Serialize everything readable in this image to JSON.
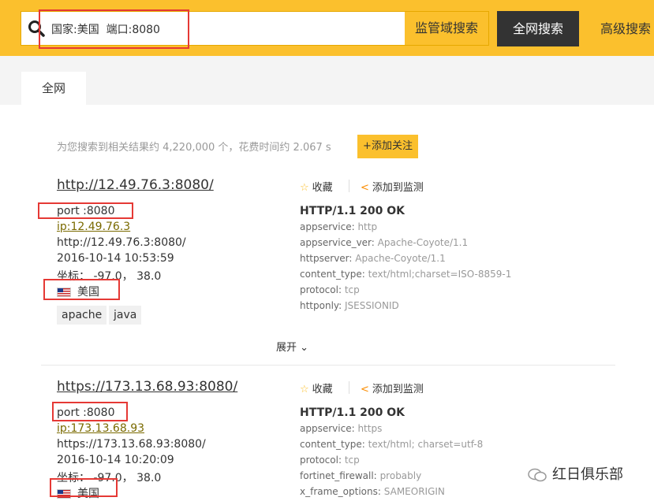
{
  "header": {
    "search_value": "国家:美国  端口:8080",
    "domain_search_label": "监管域搜索",
    "global_search_label": "全网搜索",
    "advanced_search_label": "高级搜索"
  },
  "tabs": [
    {
      "label": "全网"
    }
  ],
  "summary": {
    "text": "为您搜索到相关结果约 4,220,000 个，花费时间约 2.067 s",
    "follow_label": "+添加关注"
  },
  "results": [
    {
      "title": "http://12.49.76.3:8080/",
      "port": "port :8080",
      "ip": "ip:12.49.76.3",
      "url": "http://12.49.76.3:8080/",
      "date": "2016-10-14 10:53:59",
      "coords": "坐标： -97.0，  38.0",
      "country": "美国",
      "tags": [
        "apache",
        "java"
      ],
      "favorite_label": "收藏",
      "monitor_label": "添加到监测",
      "status": "HTTP/1.1 200 OK",
      "fields": [
        {
          "key": "appservice:",
          "value": "http"
        },
        {
          "key": "appservice_ver:",
          "value": "Apache-Coyote/1.1"
        },
        {
          "key": "httpserver:",
          "value": "Apache-Coyote/1.1"
        },
        {
          "key": "content_type:",
          "value": "text/html;charset=ISO-8859-1"
        },
        {
          "key": "protocol:",
          "value": "tcp"
        },
        {
          "key": "httponly:",
          "value": "JSESSIONID"
        }
      ],
      "expand_label": "展开"
    },
    {
      "title": "https://173.13.68.93:8080/",
      "port": "port :8080",
      "ip": "ip:173.13.68.93",
      "url": "https://173.13.68.93:8080/",
      "date": "2016-10-14 10:20:09",
      "coords": "坐标： -97.0，  38.0",
      "country": "美国",
      "favorite_label": "收藏",
      "monitor_label": "添加到监测",
      "status": "HTTP/1.1 200 OK",
      "fields": [
        {
          "key": "appservice:",
          "value": "https"
        },
        {
          "key": "content_type:",
          "value": "text/html; charset=utf-8"
        },
        {
          "key": "protocol:",
          "value": "tcp"
        },
        {
          "key": "fortinet_firewall:",
          "value": "probably"
        },
        {
          "key": "x_frame_options:",
          "value": "SAMEORIGIN"
        }
      ]
    }
  ],
  "watermark": "红日俱乐部",
  "colors": {
    "accent": "#fbc02d",
    "dark_button": "#333333",
    "annotation": "#e53935"
  }
}
